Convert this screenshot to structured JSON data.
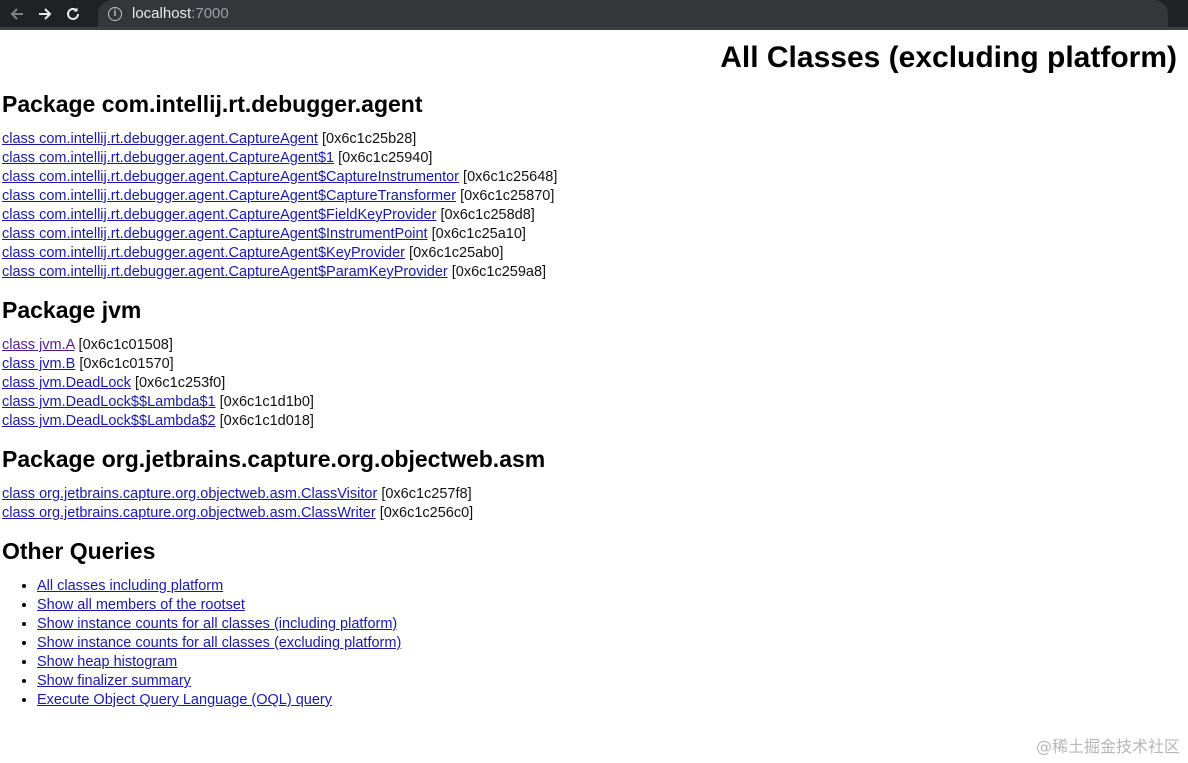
{
  "browser": {
    "url_host": "localhost",
    "url_port": ":7000"
  },
  "page": {
    "title": "All Classes (excluding platform)"
  },
  "packages": [
    {
      "heading": "Package com.intellij.rt.debugger.agent",
      "classes": [
        {
          "link": "class com.intellij.rt.debugger.agent.CaptureAgent",
          "addr": "[0x6c1c25b28]"
        },
        {
          "link": "class com.intellij.rt.debugger.agent.CaptureAgent$1",
          "addr": "[0x6c1c25940]"
        },
        {
          "link": "class com.intellij.rt.debugger.agent.CaptureAgent$CaptureInstrumentor",
          "addr": "[0x6c1c25648]"
        },
        {
          "link": "class com.intellij.rt.debugger.agent.CaptureAgent$CaptureTransformer",
          "addr": "[0x6c1c25870]"
        },
        {
          "link": "class com.intellij.rt.debugger.agent.CaptureAgent$FieldKeyProvider",
          "addr": "[0x6c1c258d8]"
        },
        {
          "link": "class com.intellij.rt.debugger.agent.CaptureAgent$InstrumentPoint",
          "addr": "[0x6c1c25a10]"
        },
        {
          "link": "class com.intellij.rt.debugger.agent.CaptureAgent$KeyProvider",
          "addr": "[0x6c1c25ab0]"
        },
        {
          "link": "class com.intellij.rt.debugger.agent.CaptureAgent$ParamKeyProvider",
          "addr": "[0x6c1c259a8]"
        }
      ]
    },
    {
      "heading": "Package jvm",
      "classes": [
        {
          "link": "class jvm.A",
          "addr": "[0x6c1c01508]"
        },
        {
          "link": "class jvm.B",
          "addr": "[0x6c1c01570]"
        },
        {
          "link": "class jvm.DeadLock",
          "addr": "[0x6c1c253f0]"
        },
        {
          "link": "class jvm.DeadLock$$Lambda$1",
          "addr": "[0x6c1c1d1b0]"
        },
        {
          "link": "class jvm.DeadLock$$Lambda$2",
          "addr": "[0x6c1c1d018]"
        }
      ]
    },
    {
      "heading": "Package org.jetbrains.capture.org.objectweb.asm",
      "classes": [
        {
          "link": "class org.jetbrains.capture.org.objectweb.asm.ClassVisitor",
          "addr": "[0x6c1c257f8]"
        },
        {
          "link": "class org.jetbrains.capture.org.objectweb.asm.ClassWriter",
          "addr": "[0x6c1c256c0]"
        }
      ]
    }
  ],
  "other_queries": {
    "heading": "Other Queries",
    "items": [
      "All classes including platform",
      "Show all members of the rootset",
      "Show instance counts for all classes (including platform)",
      "Show instance counts for all classes (excluding platform)",
      "Show heap histogram",
      "Show finalizer summary",
      "Execute Object Query Language (OQL) query"
    ]
  },
  "watermark": "@稀土掘金技术社区"
}
